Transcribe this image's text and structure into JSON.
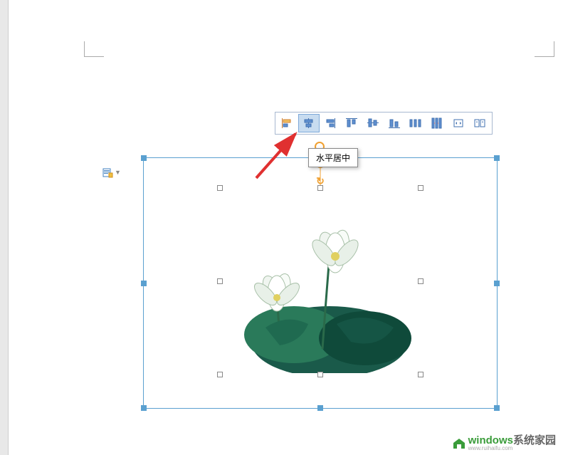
{
  "tooltip": {
    "text": "水平居中"
  },
  "toolbar": {
    "buttons": [
      {
        "name": "align-left",
        "active": false
      },
      {
        "name": "align-center-horizontal",
        "active": true
      },
      {
        "name": "align-right",
        "active": false
      },
      {
        "name": "align-top",
        "active": false
      },
      {
        "name": "align-middle-vertical",
        "active": false
      },
      {
        "name": "align-bottom",
        "active": false
      },
      {
        "name": "distribute-horizontal",
        "active": false
      },
      {
        "name": "distribute-vertical",
        "active": false
      },
      {
        "name": "equal-width",
        "active": false
      },
      {
        "name": "equal-height",
        "active": false
      }
    ]
  },
  "watermark": {
    "brand_part1": "windows",
    "brand_part2": "系统家园",
    "url": "www.ruihaifu.com"
  }
}
